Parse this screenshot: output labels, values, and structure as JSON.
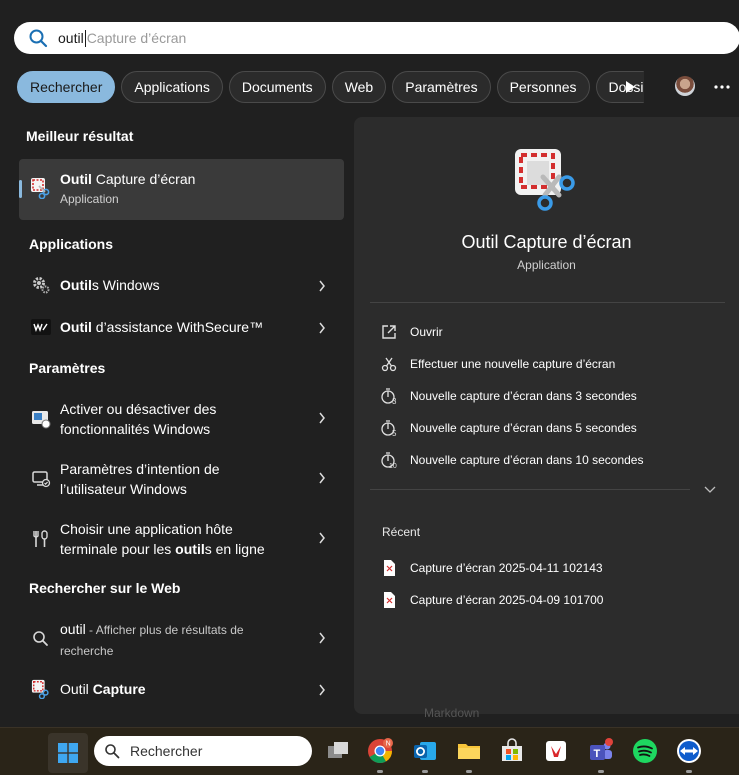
{
  "search": {
    "query": "outil",
    "suggestion_rest": "Capture d’écran"
  },
  "chips": [
    {
      "label": "Rechercher",
      "active": true
    },
    {
      "label": "Applications"
    },
    {
      "label": "Documents"
    },
    {
      "label": "Web"
    },
    {
      "label": "Paramètres"
    },
    {
      "label": "Personnes"
    },
    {
      "label": "Dossiers"
    }
  ],
  "left": {
    "best_heading": "Meilleur résultat",
    "best": {
      "title_bold": "Outil",
      "title_rest": " Capture d’écran",
      "subtitle": "Application"
    },
    "apps_heading": "Applications",
    "apps": [
      {
        "bold": "Outil",
        "rest": "s Windows"
      },
      {
        "bold": "Outil",
        "rest": " d’assistance WithSecure™"
      }
    ],
    "settings_heading": "Paramètres",
    "settings": [
      {
        "line1": "Activer ou désactiver des",
        "line2": "fonctionnalités Windows"
      },
      {
        "line1": "Paramètres d’intention de",
        "line2": "l’utilisateur Windows"
      },
      {
        "line1": "Choisir une application hôte",
        "line2_pre": "terminale pour les ",
        "line2_bold": "outil",
        "line2_post": "s en ligne"
      }
    ],
    "web_heading": "Rechercher sur le Web",
    "web": {
      "query": "outil",
      "desc1": " - Afficher plus de résultats de",
      "desc2": "recherche"
    },
    "last": {
      "pre": "Outil ",
      "bold": "Capture"
    }
  },
  "panel": {
    "app_title": "Outil Capture d’écran",
    "app_type": "Application",
    "actions": [
      {
        "label": "Ouvrir",
        "icon": "open-icon"
      },
      {
        "label": "Effectuer une nouvelle capture d’écran",
        "icon": "capture-icon"
      },
      {
        "label": "Nouvelle capture d’écran dans 3 secondes",
        "icon": "timer-3-icon"
      },
      {
        "label": "Nouvelle capture d’écran dans 5 secondes",
        "icon": "timer-5-icon"
      },
      {
        "label": "Nouvelle capture d’écran dans 10 secondes",
        "icon": "timer-10-icon"
      }
    ],
    "recent_heading": "Récent",
    "recent": [
      {
        "label": "Capture d’écran 2025-04-11 102143"
      },
      {
        "label": "Capture d’écran 2025-04-09 101700"
      }
    ]
  },
  "taskbar": {
    "search_label": "Rechercher",
    "ghost_text": "Markdown",
    "chrome_badge": "N",
    "apps": [
      "task-view-icon",
      "chrome-icon",
      "outlook-icon",
      "file-explorer-icon",
      "microsoft-store-icon",
      "pdf-reader-icon",
      "teams-icon",
      "spotify-icon",
      "teamviewer-icon"
    ]
  },
  "colors": {
    "accent": "#8ab9de",
    "panel": "#2c2c2c",
    "background": "#202020",
    "selected_row": "#3a3a3a"
  }
}
